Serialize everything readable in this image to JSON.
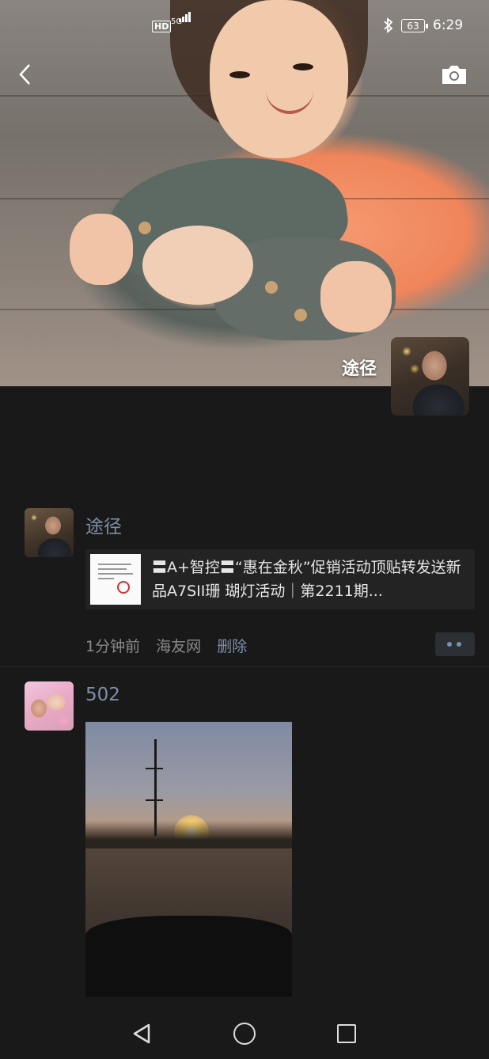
{
  "status_bar": {
    "hd": "HD",
    "network": "5G",
    "battery": "63",
    "time": "6:29"
  },
  "icons": {
    "back": "chevron-left-icon",
    "camera": "camera-icon",
    "bluetooth": "bluetooth-icon",
    "more": "more-dots-icon"
  },
  "profile": {
    "name": "途径"
  },
  "posts": [
    {
      "author": "途径",
      "link_title": "〓A+智控〓“惠在金秋”促销活动顶贴转发送新品A7SII珊 瑚灯活动｜第2211期...",
      "time": "1分钟前",
      "source": "海友网",
      "delete_label": "删除"
    },
    {
      "author": "502"
    }
  ],
  "nav_bar": [
    "back",
    "home",
    "recents"
  ]
}
